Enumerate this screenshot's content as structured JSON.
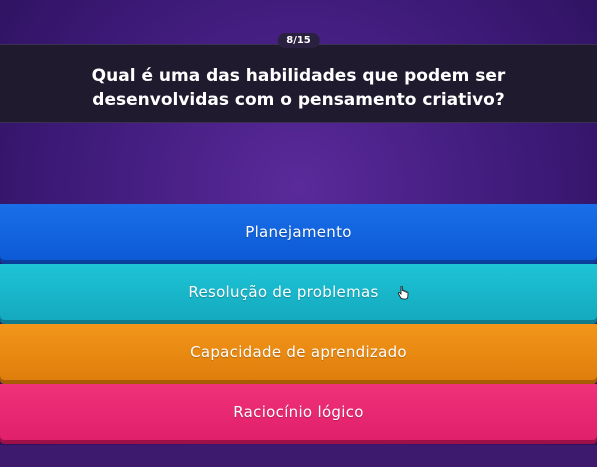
{
  "quiz": {
    "counter": "8/15",
    "question": "Qual é uma das habilidades que podem ser desenvolvidas com o pensamento criativo?"
  },
  "answers": [
    {
      "label": "Planejamento",
      "color": "#0d5ad6"
    },
    {
      "label": "Resolução de problemas",
      "color": "#14a9bf"
    },
    {
      "label": "Capacidade de aprendizado",
      "color": "#e07e0c"
    },
    {
      "label": "Raciocínio lógico",
      "color": "#e0206a"
    }
  ],
  "cursor_icon": "hand-pointer-icon"
}
